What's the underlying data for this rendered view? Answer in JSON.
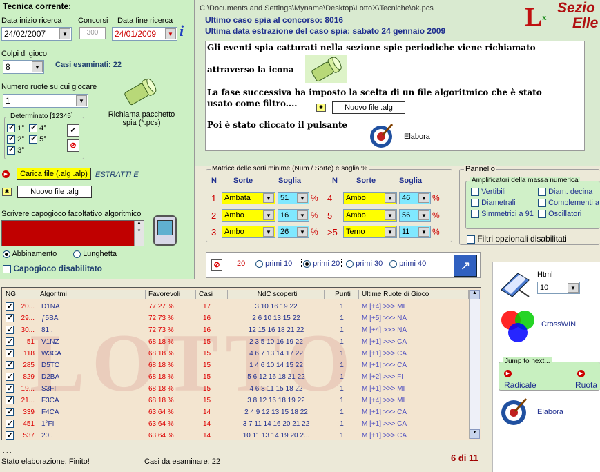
{
  "left": {
    "title": "Tecnica corrente:",
    "date_start_label": "Data inizio ricerca",
    "date_start": "24/02/2007",
    "concorsi_label": "Concorsi",
    "concorsi_value": "300",
    "date_end_label": "Data fine ricerca",
    "date_end": "24/01/2009",
    "colpi_label": "Colpi di gioco",
    "colpi_value": "8",
    "casi_esaminati": "Casi esaminati: 22",
    "ruote_label": "Numero ruote su cui giocare",
    "ruote_value": "1",
    "richiama_label": "Richiama pacchetto spia (*.pcs)",
    "determinato_label": "Determinato [12345]",
    "det": [
      "1°",
      "4°",
      "2°",
      "5°",
      "3°"
    ],
    "carica_file": "Carica file  (.alg .alp)",
    "estratti": "ESTRATTI E",
    "nuovo_file": "Nuovo file .alg",
    "capogioco_label": "Scrivere capogioco facoltativo algoritmico",
    "abbinamento": "Abbinamento",
    "lunghetta": "Lunghetta",
    "capogioco_disabilitato": "Capogioco disabilitato"
  },
  "header": {
    "path": "C:\\Documents and Settings\\Myname\\Desktop\\LottoX\\Tecniche\\ok.pcs",
    "ultimo_caso": "Ultimo caso spia al concorso:  8016",
    "ultima_data": "Ultima data estrazione del caso spia:  sabato 24 gennaio 2009",
    "brand1": "Sezio",
    "brand2": "Elle"
  },
  "info": {
    "line1": "Gli eventi spia catturati nella sezione spie periodiche viene richiamato",
    "line2": "attraverso la icona",
    "line3": "La fase successiva ha imposto la scelta di un file algoritmico che è stato usato come filtro....",
    "nuovo_file": "Nuovo file .alg",
    "line4": "Poi è stato cliccato il pulsante",
    "elabora": "Elabora"
  },
  "matrix": {
    "title": "Matrice delle sorti minime (Num / Sorte) e soglia %",
    "h_n": "N",
    "h_sorte": "Sorte",
    "h_soglia": "Soglia",
    "left": [
      {
        "n": "1",
        "sorte": "Ambata",
        "soglia": "51"
      },
      {
        "n": "2",
        "sorte": "Ambo",
        "soglia": "16"
      },
      {
        "n": "3",
        "sorte": "Ambo",
        "soglia": "26"
      }
    ],
    "right": [
      {
        "n": "4",
        "sorte": "Ambo",
        "soglia": "46"
      },
      {
        "n": "5",
        "sorte": "Ambo",
        "soglia": "56"
      },
      {
        "n": ">5",
        "sorte": "Terno",
        "soglia": "11"
      }
    ],
    "pct": "%"
  },
  "pannello": {
    "title": "Pannello",
    "amp_title": "Amplificatori della massa numerica",
    "items": [
      "Vertibili",
      "Diam. decina",
      "Diametrali",
      "Complementi a 9",
      "Simmetrici a 91",
      "Oscillatori"
    ],
    "filtri": "Filtri opzionali disabilitati"
  },
  "primi": {
    "value": "20",
    "options": [
      "primi 10",
      "primi 20",
      "primi 30",
      "primi 40"
    ]
  },
  "right": {
    "html_label": "Html",
    "html_value": "10",
    "crosswin": "CrossWIN",
    "jump_title": "Jump to next...",
    "radicale": "Radicale",
    "ruota": "Ruota",
    "elabora": "Elabora"
  },
  "table": {
    "headers": [
      "NG",
      "Algoritmi",
      "Favorevoli",
      "Casi",
      "NdC scoperti",
      "Punti",
      "Ultime Ruote di Gioco"
    ],
    "rows": [
      [
        "20...",
        "D1NA",
        "77,27 %",
        "17",
        "3 10 16 19 22",
        "1",
        "M [+4] >>> MI"
      ],
      [
        "29...",
        "ƒ5BA",
        "72,73 %",
        "16",
        "2 6 10 13 15 22",
        "1",
        "M [+5] >>> NA"
      ],
      [
        "30...",
        "81..",
        "72,73 %",
        "16",
        "12 15 16 18 21 22",
        "1",
        "M [+4] >>> NA"
      ],
      [
        "51",
        "V1NZ",
        "68,18 %",
        "15",
        "2 3 5 10 16 19 22",
        "1",
        "M [+1] >>> CA"
      ],
      [
        "118",
        "W3CA",
        "68,18 %",
        "15",
        "4 6 7 13 14 17 22",
        "1",
        "M [+1] >>> CA"
      ],
      [
        "285",
        "D5TO",
        "68,18 %",
        "15",
        "1 4 6 10 14 15 22",
        "1",
        "M [+1] >>> CA"
      ],
      [
        "829",
        "D2BA",
        "68,18 %",
        "15",
        "5 6 12 16 18 21 22",
        "1",
        "M [+2] >>> FI"
      ],
      [
        "19...",
        "S3FI",
        "68,18 %",
        "15",
        "4 6 8 11 15 18 22",
        "1",
        "M [+1] >>> MI"
      ],
      [
        "21...",
        "F3CA",
        "68,18 %",
        "15",
        "3 8 12 16 18 19 22",
        "1",
        "M [+4] >>> MI"
      ],
      [
        "339",
        "F4CA",
        "63,64 %",
        "14",
        "2 4 9 12 13 15 18 22",
        "1",
        "M [+1] >>> CA"
      ],
      [
        "451",
        "1°FI",
        "63,64 %",
        "14",
        "3 7 11 14 16 20 21 22",
        "1",
        "M [+1] >>> CA"
      ],
      [
        "537",
        "20..",
        "63,64 %",
        "14",
        "10 11 13 14 19 20 2...",
        "1",
        "M [+1] >>> CA"
      ]
    ]
  },
  "status": {
    "dots": ". . .",
    "stato": "Stato elaborazione:  Finito!",
    "casi": "Casi da esaminare: 22",
    "page": "6 di 11"
  }
}
